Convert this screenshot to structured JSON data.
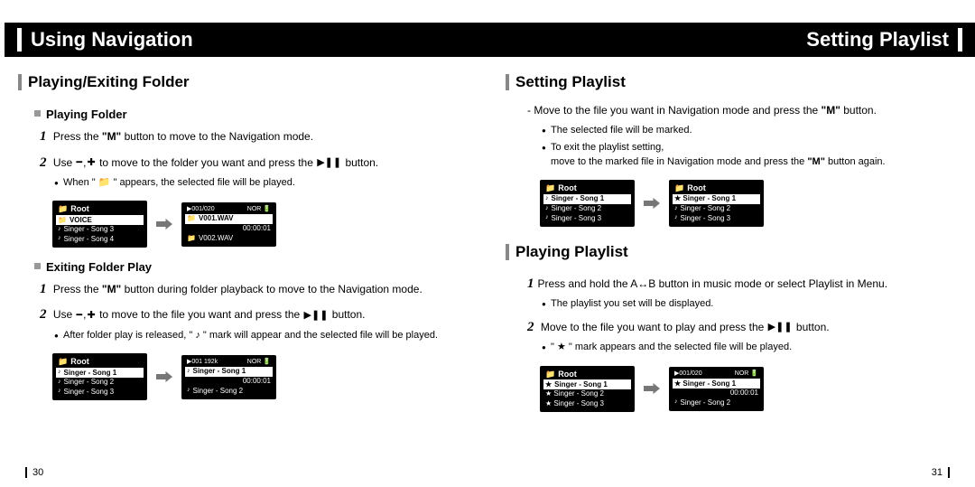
{
  "left": {
    "title": "Using Navigation",
    "pagenum": "30",
    "section": "Playing/Exiting Folder",
    "sub1": "Playing Folder",
    "s1step1_pre": "Press the ",
    "s1step1_btn": "\"M\"",
    "s1step1_post": " button to move to the Navigation mode.",
    "s1step2_pre": "Use  ",
    "s1step2_mid": " to move to the folder you want and press the  ",
    "s1step2_post": " button.",
    "s1bullet": "When \"  📁  \" appears, the selected file will be played.",
    "lcd1": {
      "hdr": "Root",
      "sel": "VOICE",
      "r1": "Singer - Song 3",
      "r2": "Singer - Song 4"
    },
    "lcd2": {
      "top_l": "▶001/020",
      "top_r": "NOR 🔋",
      "sel": "V001.WAV",
      "time": "00:00:01",
      "r1": "V002.WAV"
    },
    "sub2": "Exiting Folder Play",
    "s2step1_pre": "Press the ",
    "s2step1_btn": "\"M\"",
    "s2step1_post": " button during folder playback to move to the Navigation mode.",
    "s2step2_pre": "Use  ",
    "s2step2_mid": " to move to the file you want and press the  ",
    "s2step2_post": " button.",
    "s2bullet": "After folder play is released, \"  ♪  \" mark will appear and the selected file will be played.",
    "lcd3": {
      "hdr": "Root",
      "sel": "Singer - Song 1",
      "r1": "Singer - Song 2",
      "r2": "Singer - Song 3"
    },
    "lcd4": {
      "top_l": "▶001 192k",
      "top_r": "NOR 🔋",
      "sel": "Singer - Song 1",
      "time": "00:00:01",
      "r1": "Singer - Song 2"
    }
  },
  "right": {
    "title": "Setting Playlist",
    "pagenum": "31",
    "sectionA": "Setting Playlist",
    "a_line_pre": "- Move to the file you want in Navigation mode and press the ",
    "a_line_btn": "\"M\"",
    "a_line_post": " button.",
    "a_b1": "The selected file will be marked.",
    "a_b2a": "To exit the playlist setting,",
    "a_b2b_pre": "move to the marked file in Navigation mode and press the ",
    "a_b2b_btn": "\"M\"",
    "a_b2b_post": " button again.",
    "lcdA1": {
      "hdr": "Root",
      "sel": "Singer - Song 1",
      "r1": "Singer - Song 2",
      "r2": "Singer - Song 3"
    },
    "lcdA2": {
      "hdr": "Root",
      "sel": "★ Singer - Song 1",
      "r1": "Singer - Song 2",
      "r2": "Singer - Song 3"
    },
    "sectionB": "Playing Playlist",
    "b_step1": "Press and hold the A↔B button in music mode or select Playlist in Menu.",
    "b_b1": "The playlist you set will be displayed.",
    "b_step2_pre": "Move to the file you want to play and press the  ",
    "b_step2_post": " button.",
    "b_b2": "\" ★ \" mark appears and the selected file will be played.",
    "lcdB1": {
      "hdr": "Root",
      "sel": "Singer - Song 1",
      "r1": "★ Singer - Song 2",
      "r2": "★ Singer - Song 3"
    },
    "lcdB2": {
      "top_l": "▶001/020",
      "top_r": "NOR 🔋",
      "sel": "★ Singer - Song 1",
      "time": "00:00:01",
      "r1": "Singer - Song 2"
    }
  }
}
